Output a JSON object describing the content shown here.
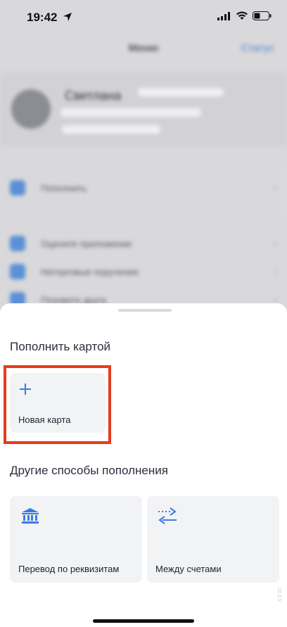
{
  "status_bar": {
    "time": "19:42"
  },
  "background": {
    "title": "Меню",
    "status_link": "Статус",
    "profile_name": "Светлана",
    "menu_items": [
      {
        "label": "Пополнить"
      },
      {
        "label": "Оцените приложение"
      },
      {
        "label": "Неторговые поручения"
      },
      {
        "label": "Позовите друга"
      }
    ]
  },
  "sheet": {
    "card_section_title": "Пополнить картой",
    "new_card_label": "Новая карта",
    "other_section_title": "Другие способы пополнения",
    "options": [
      {
        "label": "Перевод по реквизитам",
        "icon": "bank-icon"
      },
      {
        "label": "Между счетами",
        "icon": "transfer-arrows-icon"
      }
    ],
    "version": "22.3.5"
  },
  "colors": {
    "accent": "#3b7be0",
    "highlight": "#e63b1c",
    "card_bg": "#f2f3f5"
  }
}
